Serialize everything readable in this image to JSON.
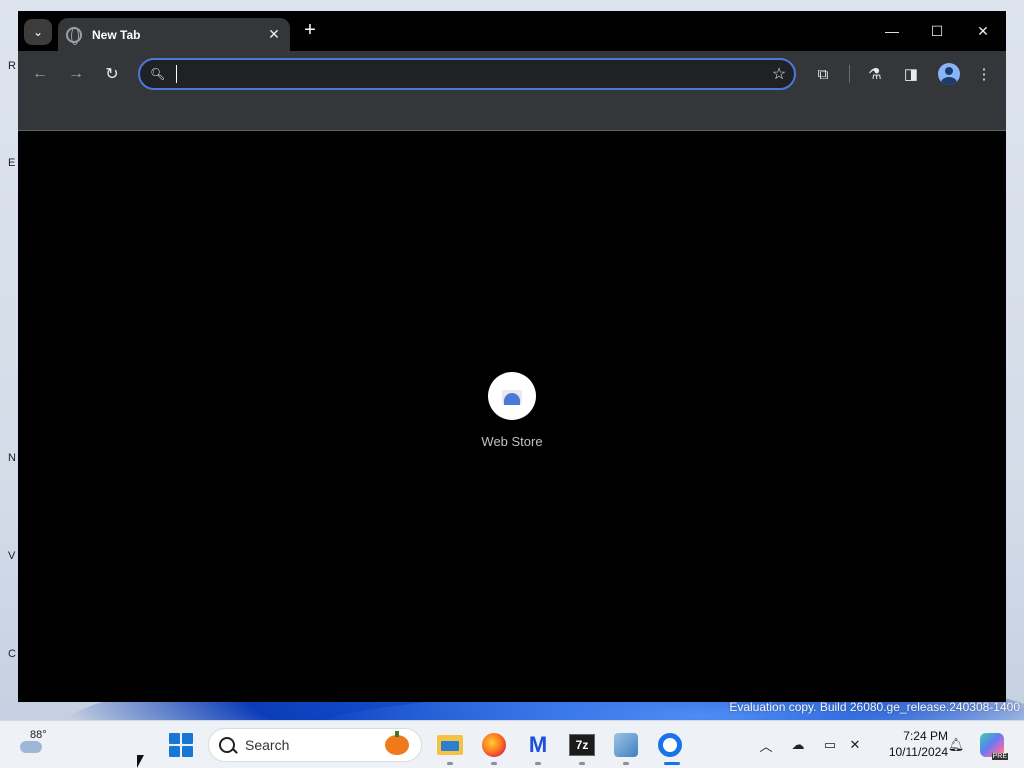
{
  "browser": {
    "tab": {
      "title": "New Tab"
    },
    "omnibox": {
      "value": "",
      "placeholder": ""
    },
    "shortcut": {
      "label": "Web Store"
    }
  },
  "desktop": {
    "edge_letters": [
      "R",
      "E",
      "N",
      "V",
      "C"
    ],
    "watermark": "Evaluation copy. Build 26080.ge_release.240308-1400"
  },
  "taskbar": {
    "weather": {
      "temp": "88°",
      "icon": "weather-cloud-icon"
    },
    "search": {
      "label": "Search"
    },
    "apps": [
      {
        "name": "file-explorer",
        "icon": "folder-icon"
      },
      {
        "name": "firefox",
        "icon": "firefox-icon"
      },
      {
        "name": "malwarebytes",
        "icon": "malwarebytes-icon",
        "glyph": "M"
      },
      {
        "name": "7-zip",
        "icon": "7zip-icon",
        "glyph": "7z"
      },
      {
        "name": "tool",
        "icon": "tool-icon"
      },
      {
        "name": "chrome",
        "icon": "chrome-icon",
        "active": true
      }
    ],
    "clock": {
      "time": "7:24 PM",
      "date": "10/11/2024"
    },
    "copilot_badge": "PRE"
  },
  "colors": {
    "accent": "#1a73e8",
    "omnibox_border": "#4a7ad6",
    "toolbar_bg": "#35363a",
    "page_bg": "#000000"
  }
}
